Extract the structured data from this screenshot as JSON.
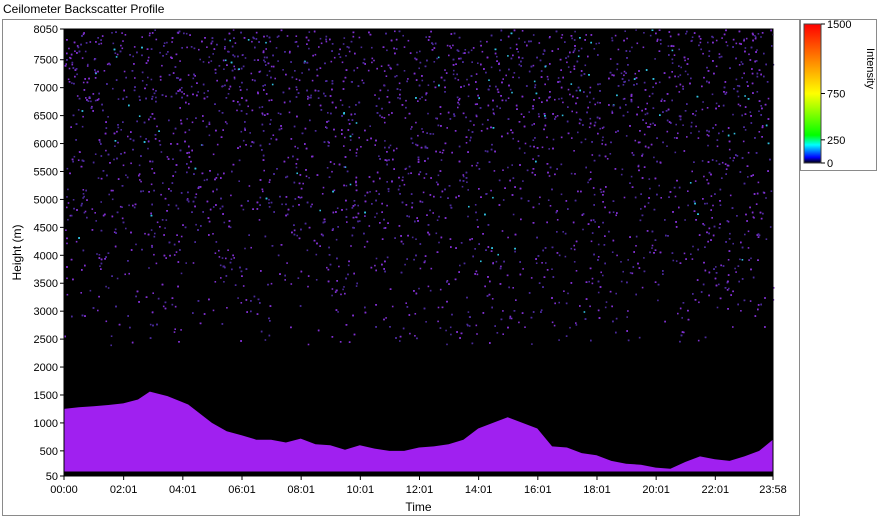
{
  "window": {
    "title": "Ceilometer Backscatter Profile"
  },
  "colors": {
    "background": "#000000",
    "aerosol_layer": "#a020f0",
    "noise_high": "#4a2a9a",
    "noise_mid": "#8030d0",
    "noise_cyan": "#30c0e0",
    "legend_low": "#000000",
    "legend_high": "#ff0000"
  },
  "chart_data": {
    "type": "heatmap",
    "title": "Ceilometer Backscatter Profile",
    "xlabel": "Time",
    "ylabel": "Height (m)",
    "x_tick_labels": [
      "00:00",
      "02:01",
      "04:01",
      "06:01",
      "08:01",
      "10:01",
      "12:01",
      "14:01",
      "16:01",
      "18:01",
      "20:01",
      "22:01",
      "23:58"
    ],
    "x_ticks_hours": [
      0,
      2.0167,
      4.0167,
      6.0167,
      8.0167,
      10.0167,
      12.0167,
      14.0167,
      16.0167,
      18.0167,
      20.0167,
      22.0167,
      23.9667
    ],
    "xlim_hours": [
      0,
      23.9667
    ],
    "y_ticks": [
      50,
      500,
      1000,
      1500,
      2000,
      2500,
      3000,
      3500,
      4000,
      4500,
      5000,
      5500,
      6000,
      6500,
      7000,
      7500,
      8050
    ],
    "ylim": [
      50,
      8050
    ],
    "colorbar": {
      "label": "Intensity",
      "ticks": [
        0,
        250,
        750,
        1500
      ],
      "range": [
        0,
        1500
      ]
    },
    "boundary_layer_top_m": {
      "hours": [
        0,
        0.5,
        1,
        1.5,
        2,
        2.5,
        2.9,
        3.5,
        4.2,
        5,
        5.5,
        6,
        6.5,
        7,
        7.5,
        8,
        8.5,
        9,
        9.5,
        10,
        10.5,
        11,
        11.5,
        12,
        12.5,
        13,
        13.5,
        14,
        14.5,
        15,
        15.5,
        16,
        16.5,
        17,
        17.5,
        18,
        18.5,
        19,
        19.5,
        20,
        20.5,
        21,
        21.5,
        22,
        22.5,
        23,
        23.5,
        23.96
      ],
      "heights": [
        1250,
        1280,
        1300,
        1320,
        1350,
        1420,
        1560,
        1480,
        1330,
        1000,
        850,
        780,
        700,
        700,
        650,
        720,
        620,
        600,
        520,
        600,
        540,
        500,
        500,
        560,
        580,
        620,
        700,
        900,
        1000,
        1100,
        1000,
        900,
        580,
        560,
        460,
        420,
        320,
        270,
        250,
        200,
        180,
        300,
        400,
        350,
        320,
        400,
        500,
        700
      ]
    },
    "ground_band_m": [
      50,
      130
    ]
  }
}
